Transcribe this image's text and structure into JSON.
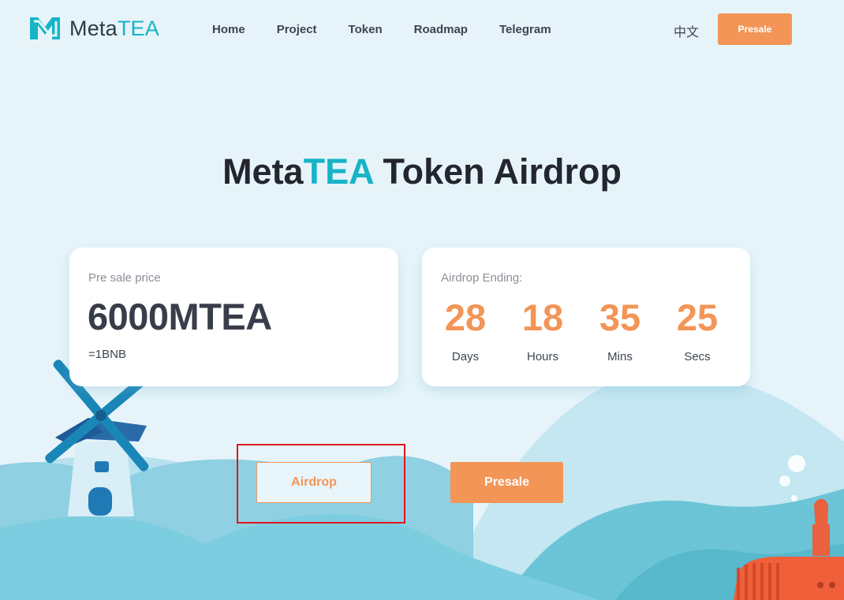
{
  "brand": {
    "name_part1": "Meta",
    "name_part2": "TEA"
  },
  "nav": {
    "items": [
      {
        "label": "Home"
      },
      {
        "label": "Project"
      },
      {
        "label": "Token"
      },
      {
        "label": "Roadmap"
      },
      {
        "label": "Telegram"
      }
    ],
    "language": "中文",
    "presale_label": "Presale"
  },
  "hero": {
    "title_part1": "Meta",
    "title_part2": "TEA",
    "title_part3": " Token Airdrop"
  },
  "price_card": {
    "label": "Pre sale price",
    "value": "6000MTEA",
    "sub": "=1BNB"
  },
  "countdown": {
    "label": "Airdrop Ending:",
    "units": [
      {
        "value": "28",
        "label": "Days"
      },
      {
        "value": "18",
        "label": "Hours"
      },
      {
        "value": "35",
        "label": "Mins"
      },
      {
        "value": "25",
        "label": "Secs"
      }
    ]
  },
  "actions": {
    "airdrop_label": "Airdrop",
    "presale_label": "Presale"
  },
  "colors": {
    "accent": "#17b3c7",
    "orange": "#f29557",
    "background": "#e6f4fa",
    "highlight": "#e0161c"
  }
}
